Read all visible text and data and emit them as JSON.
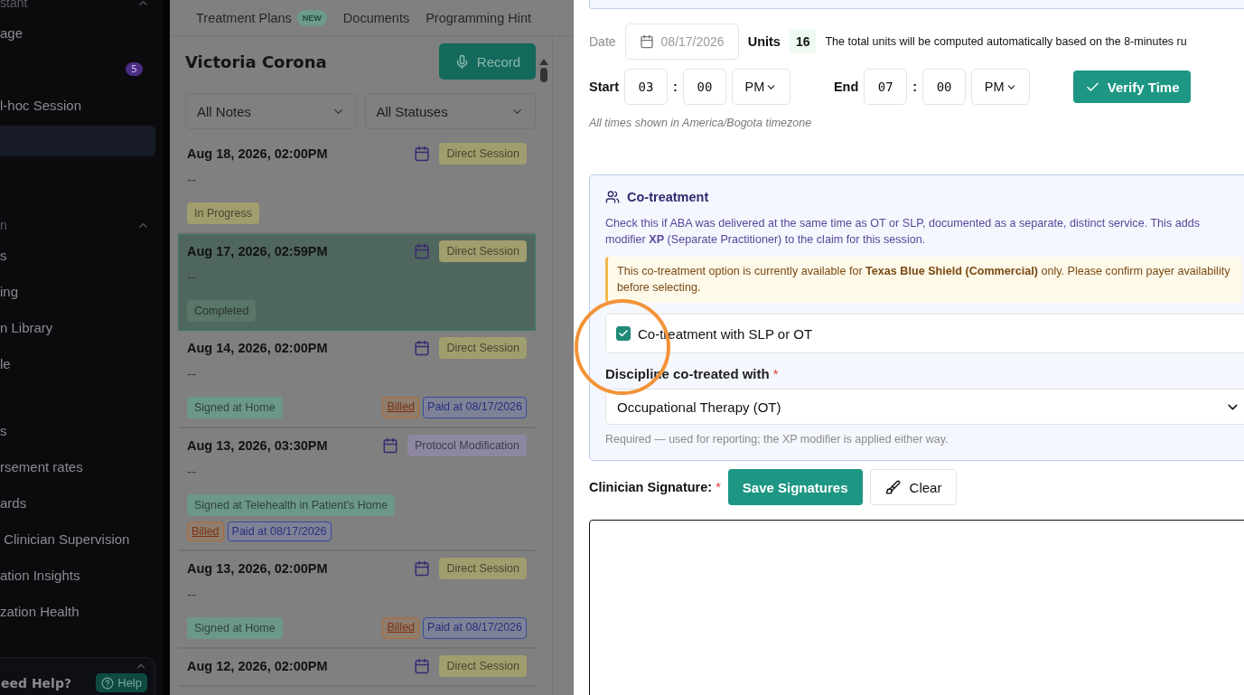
{
  "sidebar": {
    "sections": [
      {
        "header": "stant",
        "expanded": true,
        "items": [
          {
            "label": "age",
            "selected": false
          },
          {
            "badge": "5",
            "selected": false
          },
          {
            "label": "l-hoc Session",
            "selected": false
          },
          {
            "selected": true
          }
        ]
      },
      {
        "header": "n",
        "expanded": true,
        "items": [
          {
            "label": "s",
            "selected": false
          },
          {
            "label": "ing",
            "selected": false
          },
          {
            "label": "n Library",
            "selected": false
          },
          {
            "label": "le",
            "selected": false
          }
        ]
      },
      {
        "items": [
          {
            "label": "s",
            "selected": false
          },
          {
            "label": "rsement rates",
            "selected": false
          },
          {
            "label": "ards",
            "selected": false
          },
          {
            "label": " Clinician Supervision",
            "selected": false
          },
          {
            "label": "ation Insights",
            "selected": false
          },
          {
            "label": "zation Health",
            "selected": false
          }
        ]
      }
    ],
    "help": {
      "title": "eed Help?",
      "button": "Help",
      "expanded": false
    }
  },
  "tabs": [
    {
      "label": "Treatment Plans",
      "badge": "NEW"
    },
    {
      "label": "Documents"
    },
    {
      "label": "Programming Hint"
    }
  ],
  "patient": {
    "name": "Victoria Corona",
    "record_button": "Record"
  },
  "filters": [
    "All Notes",
    "All Statuses"
  ],
  "notes": [
    {
      "date": "Aug 18, 2026, 02:00PM",
      "type": {
        "label": "Direct Session",
        "color": "#a09d6e"
      },
      "summary": "--",
      "status": {
        "label": "In Progress",
        "color": "#a09d6e"
      },
      "selected": false
    },
    {
      "date": "Aug 17, 2026, 02:59PM",
      "type": {
        "label": "Direct Session",
        "color": "#a09d6e"
      },
      "summary": "--",
      "status": {
        "label": "Completed",
        "color": "#5a7668"
      },
      "selected": true
    },
    {
      "date": "Aug 14, 2026, 02:00PM",
      "type": {
        "label": "Direct Session",
        "color": "#a09d6e"
      },
      "summary": "--",
      "status": {
        "label": "Signed at Home",
        "color": "#6c9887"
      },
      "billed": "Billed",
      "paid": "Paid at 08/17/2026",
      "selected": false
    },
    {
      "date": "Aug 13, 2026, 03:30PM",
      "type": {
        "label": "Protocol Modification",
        "color": "#8e87a1"
      },
      "summary": "--",
      "status": {
        "label": "Signed at Telehealth in Patient's Home",
        "color": "#6c9887"
      },
      "billed": "Billed",
      "paid": "Paid at 08/17/2026",
      "selected": false
    },
    {
      "date": "Aug 13, 2026, 02:00PM",
      "type": {
        "label": "Direct Session",
        "color": "#a09d6e"
      },
      "summary": "--",
      "status": {
        "label": "Signed at Home",
        "color": "#6c9887"
      },
      "billed": "Billed",
      "paid": "Paid at 08/17/2026",
      "selected": false
    },
    {
      "date": "Aug 12, 2026, 02:00PM",
      "type": {
        "label": "Direct Session",
        "color": "#a09d6e"
      },
      "selected": false
    }
  ],
  "session": {
    "date_label": "Date",
    "date": "08/17/2026",
    "units_label": "Units",
    "units": "16",
    "units_note": "The total units will be computed automatically based on the 8-minutes ru",
    "start_label": "Start",
    "start_hour": "03",
    "start_minute": "00",
    "start_period": "PM",
    "separator": ":",
    "end_label": "End",
    "end_hour": "07",
    "end_minute": "00",
    "end_period": "PM",
    "verify_button": "Verify Time",
    "timezone_note": "All times shown in America/Bogota timezone"
  },
  "cotreatment": {
    "title": "Co-treatment",
    "description": "Check this if ABA was delivered at the same time as OT or SLP, documented as a separate, distinct service. This adds modifier **XP** (Separate Practitioner) to the claim for this session.",
    "warning": "This co-treatment option is currently available for **Texas Blue Shield (Commercial)** only. Please confirm payer availability before selecting.",
    "checkbox_label": "Co-treatment with SLP or OT",
    "checked": true,
    "discipline_label": "Discipline co-treated with",
    "required_mark": "*",
    "discipline": "Occupational Therapy (OT)",
    "hint": "Required — used for reporting; the XP modifier is applied either way."
  },
  "signature": {
    "label": "Clinician Signature:",
    "required_mark": "*",
    "save_button": "Save Signatures",
    "clear_button": "Clear"
  }
}
